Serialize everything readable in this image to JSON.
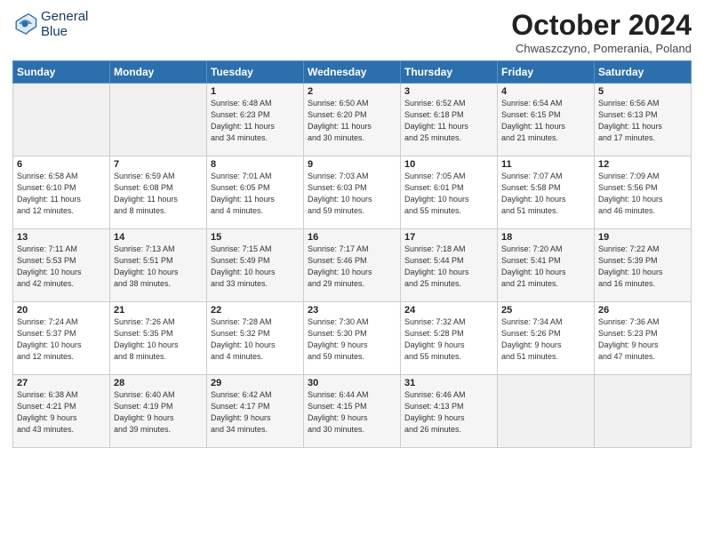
{
  "header": {
    "logo_line1": "General",
    "logo_line2": "Blue",
    "month": "October 2024",
    "location": "Chwaszczyno, Pomerania, Poland"
  },
  "days_of_week": [
    "Sunday",
    "Monday",
    "Tuesday",
    "Wednesday",
    "Thursday",
    "Friday",
    "Saturday"
  ],
  "weeks": [
    [
      {
        "day": "",
        "detail": ""
      },
      {
        "day": "",
        "detail": ""
      },
      {
        "day": "1",
        "detail": "Sunrise: 6:48 AM\nSunset: 6:23 PM\nDaylight: 11 hours\nand 34 minutes."
      },
      {
        "day": "2",
        "detail": "Sunrise: 6:50 AM\nSunset: 6:20 PM\nDaylight: 11 hours\nand 30 minutes."
      },
      {
        "day": "3",
        "detail": "Sunrise: 6:52 AM\nSunset: 6:18 PM\nDaylight: 11 hours\nand 25 minutes."
      },
      {
        "day": "4",
        "detail": "Sunrise: 6:54 AM\nSunset: 6:15 PM\nDaylight: 11 hours\nand 21 minutes."
      },
      {
        "day": "5",
        "detail": "Sunrise: 6:56 AM\nSunset: 6:13 PM\nDaylight: 11 hours\nand 17 minutes."
      }
    ],
    [
      {
        "day": "6",
        "detail": "Sunrise: 6:58 AM\nSunset: 6:10 PM\nDaylight: 11 hours\nand 12 minutes."
      },
      {
        "day": "7",
        "detail": "Sunrise: 6:59 AM\nSunset: 6:08 PM\nDaylight: 11 hours\nand 8 minutes."
      },
      {
        "day": "8",
        "detail": "Sunrise: 7:01 AM\nSunset: 6:05 PM\nDaylight: 11 hours\nand 4 minutes."
      },
      {
        "day": "9",
        "detail": "Sunrise: 7:03 AM\nSunset: 6:03 PM\nDaylight: 10 hours\nand 59 minutes."
      },
      {
        "day": "10",
        "detail": "Sunrise: 7:05 AM\nSunset: 6:01 PM\nDaylight: 10 hours\nand 55 minutes."
      },
      {
        "day": "11",
        "detail": "Sunrise: 7:07 AM\nSunset: 5:58 PM\nDaylight: 10 hours\nand 51 minutes."
      },
      {
        "day": "12",
        "detail": "Sunrise: 7:09 AM\nSunset: 5:56 PM\nDaylight: 10 hours\nand 46 minutes."
      }
    ],
    [
      {
        "day": "13",
        "detail": "Sunrise: 7:11 AM\nSunset: 5:53 PM\nDaylight: 10 hours\nand 42 minutes."
      },
      {
        "day": "14",
        "detail": "Sunrise: 7:13 AM\nSunset: 5:51 PM\nDaylight: 10 hours\nand 38 minutes."
      },
      {
        "day": "15",
        "detail": "Sunrise: 7:15 AM\nSunset: 5:49 PM\nDaylight: 10 hours\nand 33 minutes."
      },
      {
        "day": "16",
        "detail": "Sunrise: 7:17 AM\nSunset: 5:46 PM\nDaylight: 10 hours\nand 29 minutes."
      },
      {
        "day": "17",
        "detail": "Sunrise: 7:18 AM\nSunset: 5:44 PM\nDaylight: 10 hours\nand 25 minutes."
      },
      {
        "day": "18",
        "detail": "Sunrise: 7:20 AM\nSunset: 5:41 PM\nDaylight: 10 hours\nand 21 minutes."
      },
      {
        "day": "19",
        "detail": "Sunrise: 7:22 AM\nSunset: 5:39 PM\nDaylight: 10 hours\nand 16 minutes."
      }
    ],
    [
      {
        "day": "20",
        "detail": "Sunrise: 7:24 AM\nSunset: 5:37 PM\nDaylight: 10 hours\nand 12 minutes."
      },
      {
        "day": "21",
        "detail": "Sunrise: 7:26 AM\nSunset: 5:35 PM\nDaylight: 10 hours\nand 8 minutes."
      },
      {
        "day": "22",
        "detail": "Sunrise: 7:28 AM\nSunset: 5:32 PM\nDaylight: 10 hours\nand 4 minutes."
      },
      {
        "day": "23",
        "detail": "Sunrise: 7:30 AM\nSunset: 5:30 PM\nDaylight: 9 hours\nand 59 minutes."
      },
      {
        "day": "24",
        "detail": "Sunrise: 7:32 AM\nSunset: 5:28 PM\nDaylight: 9 hours\nand 55 minutes."
      },
      {
        "day": "25",
        "detail": "Sunrise: 7:34 AM\nSunset: 5:26 PM\nDaylight: 9 hours\nand 51 minutes."
      },
      {
        "day": "26",
        "detail": "Sunrise: 7:36 AM\nSunset: 5:23 PM\nDaylight: 9 hours\nand 47 minutes."
      }
    ],
    [
      {
        "day": "27",
        "detail": "Sunrise: 6:38 AM\nSunset: 4:21 PM\nDaylight: 9 hours\nand 43 minutes."
      },
      {
        "day": "28",
        "detail": "Sunrise: 6:40 AM\nSunset: 4:19 PM\nDaylight: 9 hours\nand 39 minutes."
      },
      {
        "day": "29",
        "detail": "Sunrise: 6:42 AM\nSunset: 4:17 PM\nDaylight: 9 hours\nand 34 minutes."
      },
      {
        "day": "30",
        "detail": "Sunrise: 6:44 AM\nSunset: 4:15 PM\nDaylight: 9 hours\nand 30 minutes."
      },
      {
        "day": "31",
        "detail": "Sunrise: 6:46 AM\nSunset: 4:13 PM\nDaylight: 9 hours\nand 26 minutes."
      },
      {
        "day": "",
        "detail": ""
      },
      {
        "day": "",
        "detail": ""
      }
    ]
  ]
}
